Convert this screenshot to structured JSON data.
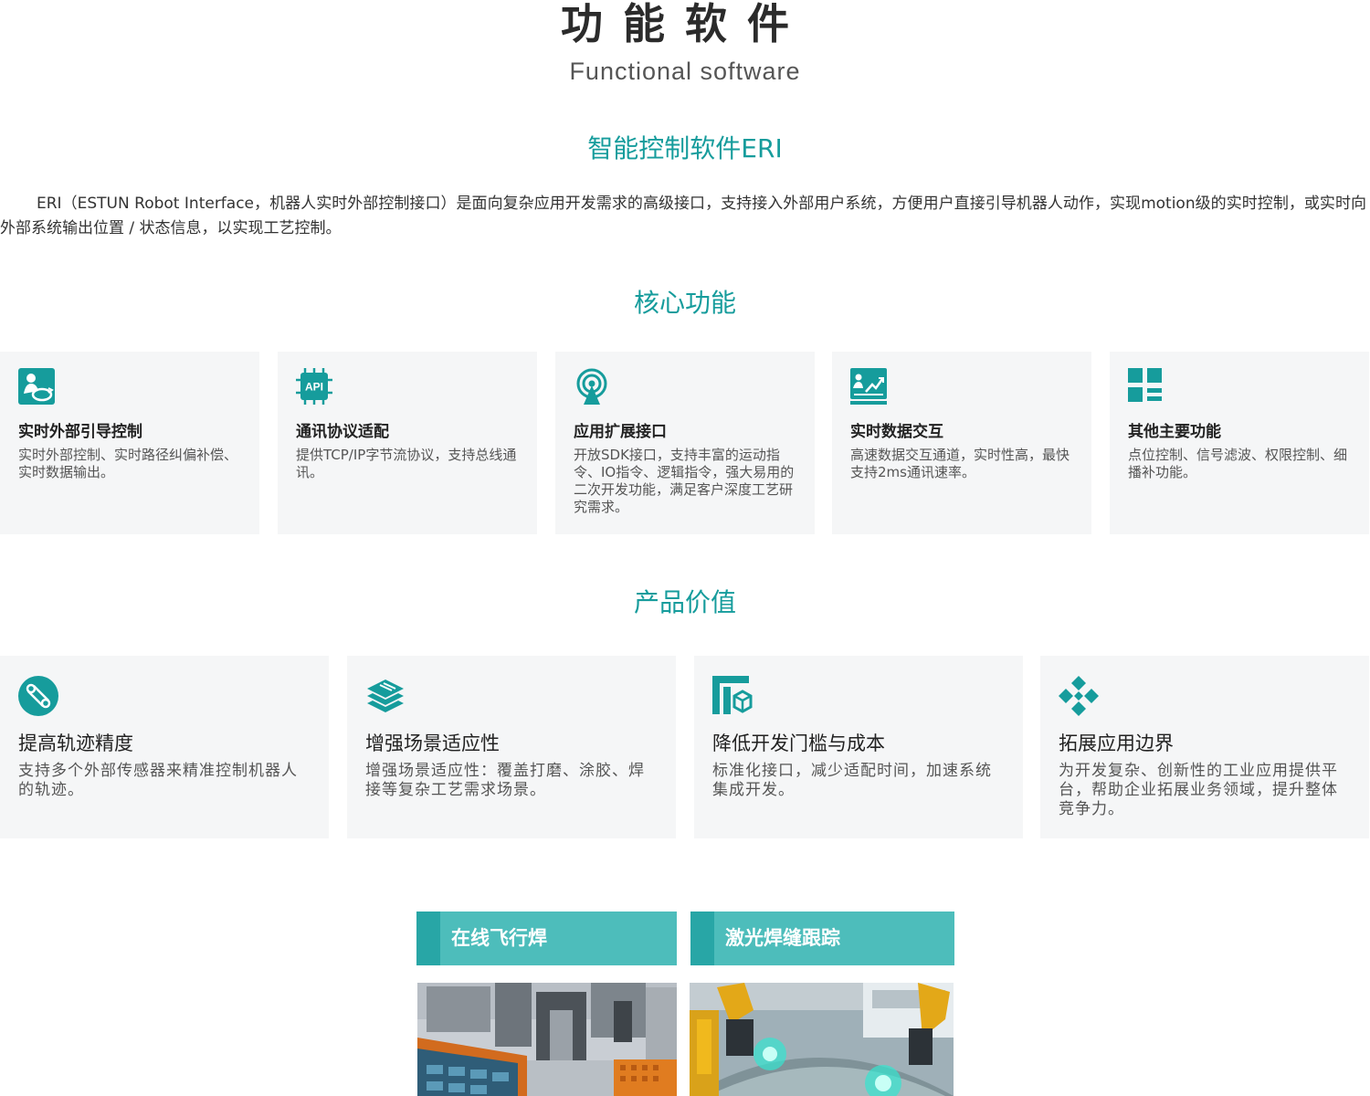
{
  "header": {
    "title": "功能软件",
    "subtitle": "Functional software"
  },
  "eri": {
    "title": "智能控制软件ERI",
    "description": "ERI（ESTUN Robot Interface，机器人实时外部控制接口）是面向复杂应用开发需求的高级接口，支持接入外部用户系统，方便用户直接引导机器人动作，实现motion级的实时控制，或实时向外部系统输出位置 / 状态信息，以实现工艺控制。"
  },
  "core": {
    "title": "核心功能",
    "cards": [
      {
        "icon": "robot-guide-icon",
        "title": "实时外部引导控制",
        "desc": "实时外部控制、实时路径纠偏补偿、实时数据输出。"
      },
      {
        "icon": "api-chip-icon",
        "title": "通讯协议适配",
        "desc": "提供TCP/IP字节流协议，支持总线通讯。"
      },
      {
        "icon": "signal-tower-icon",
        "title": "应用扩展接口",
        "desc": "开放SDK接口，支持丰富的运动指令、IO指令、逻辑指令，强大易用的二次开发功能，满足客户深度工艺研究需求。"
      },
      {
        "icon": "data-exchange-icon",
        "title": "实时数据交互",
        "desc": "高速数据交互通道，实时性高，最快支持2ms通讯速率。"
      },
      {
        "icon": "grid-apps-icon",
        "title": "其他主要功能",
        "desc": "点位控制、信号滤波、权限控制、细播补功能。"
      }
    ]
  },
  "value": {
    "title": "产品价值",
    "cards": [
      {
        "icon": "precision-icon",
        "title": "提高轨迹精度",
        "desc": "支持多个外部传感器来精准控制机器人的轨迹。"
      },
      {
        "icon": "layers-icon",
        "title": "增强场景适应性",
        "desc": "增强场景适应性：覆盖打磨、涂胶、焊接等复杂工艺需求场景。"
      },
      {
        "icon": "standard-box-icon",
        "title": "降低开发门槛与成本",
        "desc": "标准化接口，减少适配时间，加速系统集成开发。"
      },
      {
        "icon": "expand-diamond-icon",
        "title": "拓展应用边界",
        "desc": "为开发复杂、创新性的工业应用提供平台，帮助企业拓展业务领域，提升整体竞争力。"
      }
    ]
  },
  "cases": [
    {
      "label": "在线飞行焊"
    },
    {
      "label": "激光焊缝跟踪"
    }
  ],
  "colors": {
    "accent": "#169c9c",
    "tab": "#4dbdbb",
    "tab_edge": "#28a6a6",
    "card_bg": "#f5f6f7"
  }
}
